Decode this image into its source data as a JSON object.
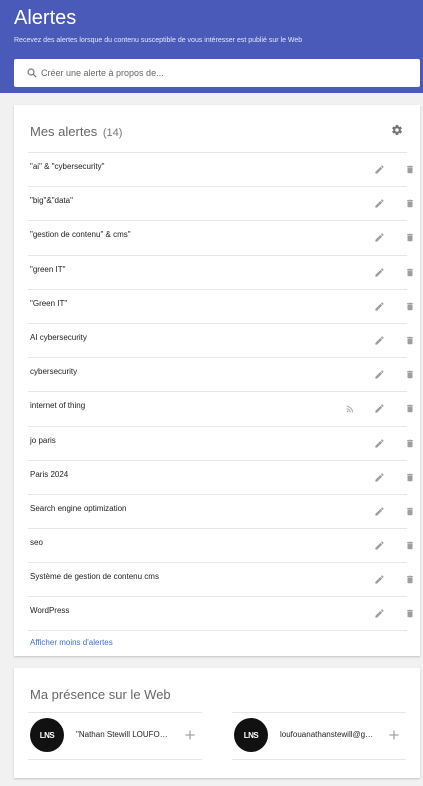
{
  "header": {
    "title": "Alertes",
    "subtitle": "Recevez des alertes lorsque du contenu susceptible de vous intéresser est publié sur le Web",
    "color": "#4a5ab9"
  },
  "search": {
    "placeholder": "Créer une alerte à propos de...",
    "value": ""
  },
  "alerts_card": {
    "title": "Mes alertes",
    "count": "(14)",
    "items": [
      {
        "label": "\"ai\" & \"cybersecurity\"",
        "rss": false
      },
      {
        "label": "\"big\"&\"data\"",
        "rss": false
      },
      {
        "label": "\"gestion de contenu\" & cms\"",
        "rss": false
      },
      {
        "label": "\"green IT\"",
        "rss": false
      },
      {
        "label": "\"Green IT\"",
        "rss": false
      },
      {
        "label": "AI cybersecurity",
        "rss": false
      },
      {
        "label": "cybersecurity",
        "rss": false
      },
      {
        "label": "internet of thing",
        "rss": true
      },
      {
        "label": "jo paris",
        "rss": false
      },
      {
        "label": "Paris 2024",
        "rss": false
      },
      {
        "label": "Search engine optimization",
        "rss": false
      },
      {
        "label": "seo",
        "rss": false
      },
      {
        "label": "Système de gestion de contenu cms",
        "rss": false
      },
      {
        "label": "WordPress",
        "rss": false
      }
    ],
    "show_less_link": "Afficher moins d'alertes",
    "link_color": "#3b6fd6"
  },
  "presence_card": {
    "title": "Ma présence sur le Web",
    "profiles": [
      {
        "avatar_text": "LNS",
        "name": "\"Nathan Stewill LOUFOUANA\""
      },
      {
        "avatar_text": "LNS",
        "name": "loufouanathanstewill@gmail.com"
      }
    ]
  },
  "icons": {
    "search": "search-icon",
    "settings": "gear-icon",
    "edit": "pencil-icon",
    "delete": "trash-icon",
    "feed": "rss-icon",
    "add": "plus-icon"
  }
}
